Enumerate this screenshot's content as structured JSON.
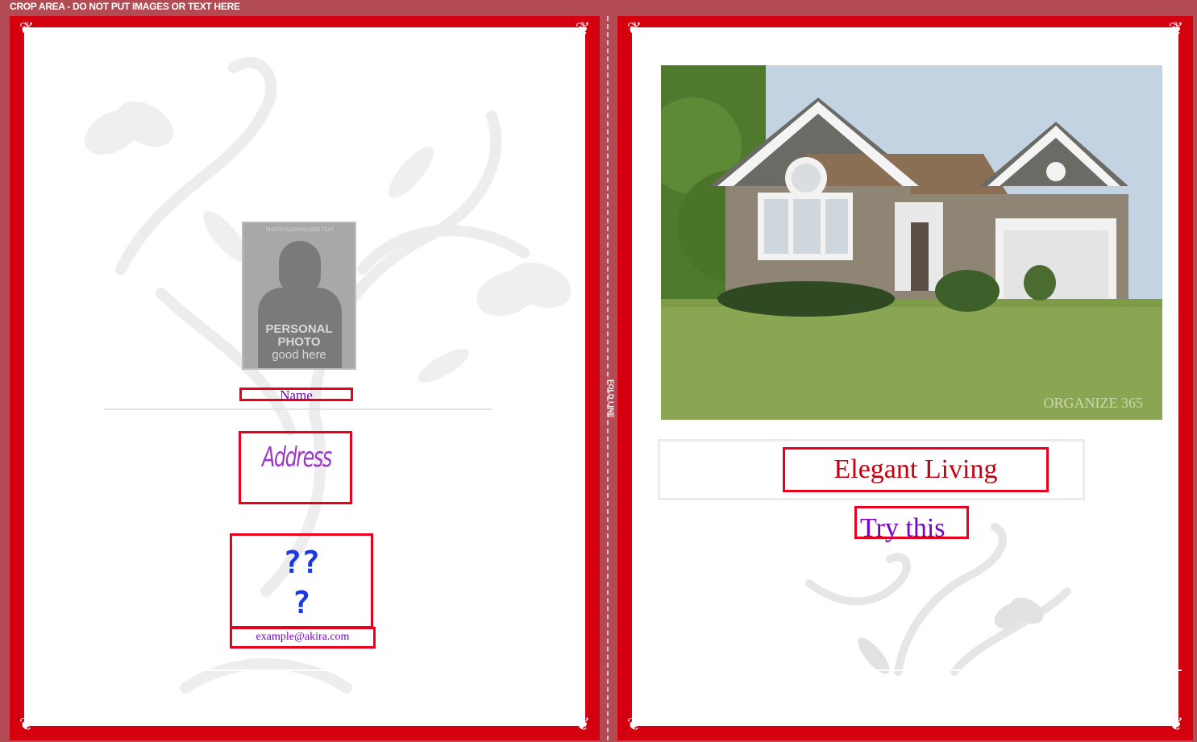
{
  "crop_notice": "CROP AREA - DO NOT PUT IMAGES OR TEXT HERE",
  "fold_label": "FOLD LINE",
  "left_page": {
    "photo_placeholder": {
      "top_caption": "PHOTO PLACEHOLDER TEXT",
      "line1": "PERSONAL",
      "line2": "PHOTO",
      "line3": "good here"
    },
    "name": "Name",
    "address": "Address",
    "question_marks_line1": "??",
    "question_marks_line2": "?",
    "email": "example@akira.com"
  },
  "right_page": {
    "photo_watermark": "ORGANIZE 365",
    "title": "Elegant Living",
    "subtitle": "Try this"
  },
  "colors": {
    "frame_red": "#d4000f",
    "crop_bg": "#b24b53",
    "box_border": "#e8001c",
    "name_text": "#7a00c8",
    "title_text": "#c8000d",
    "question_text": "#1b38e3"
  }
}
